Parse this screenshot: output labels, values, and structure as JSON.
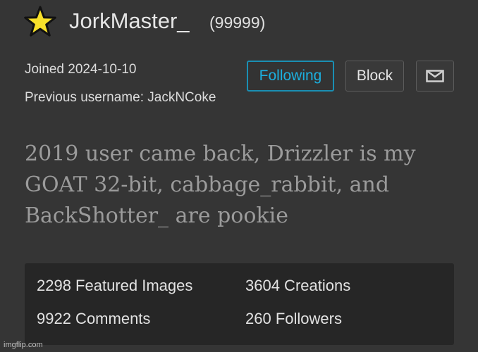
{
  "profile": {
    "username": "JorkMaster_",
    "points": "(99999)",
    "joined": "Joined 2024-10-10",
    "previous_username": "Previous username: JackNCoke",
    "bio": "2019 user came back, Drizzler is my\nGOAT 32-bit, cabbage_rabbit, and\nBackShotter_ are pookie",
    "star_icon": "star-icon"
  },
  "actions": {
    "following_label": "Following",
    "block_label": "Block",
    "mail_icon": "mail-icon"
  },
  "stats": {
    "featured_images": "2298 Featured Images",
    "creations": "3604 Creations",
    "comments": "9922 Comments",
    "followers": "260 Followers"
  },
  "watermark": "imgflip.com",
  "colors": {
    "background": "#353535",
    "stats_background": "#262626",
    "accent": "#1cb0e0",
    "star": "#f7e02a"
  }
}
